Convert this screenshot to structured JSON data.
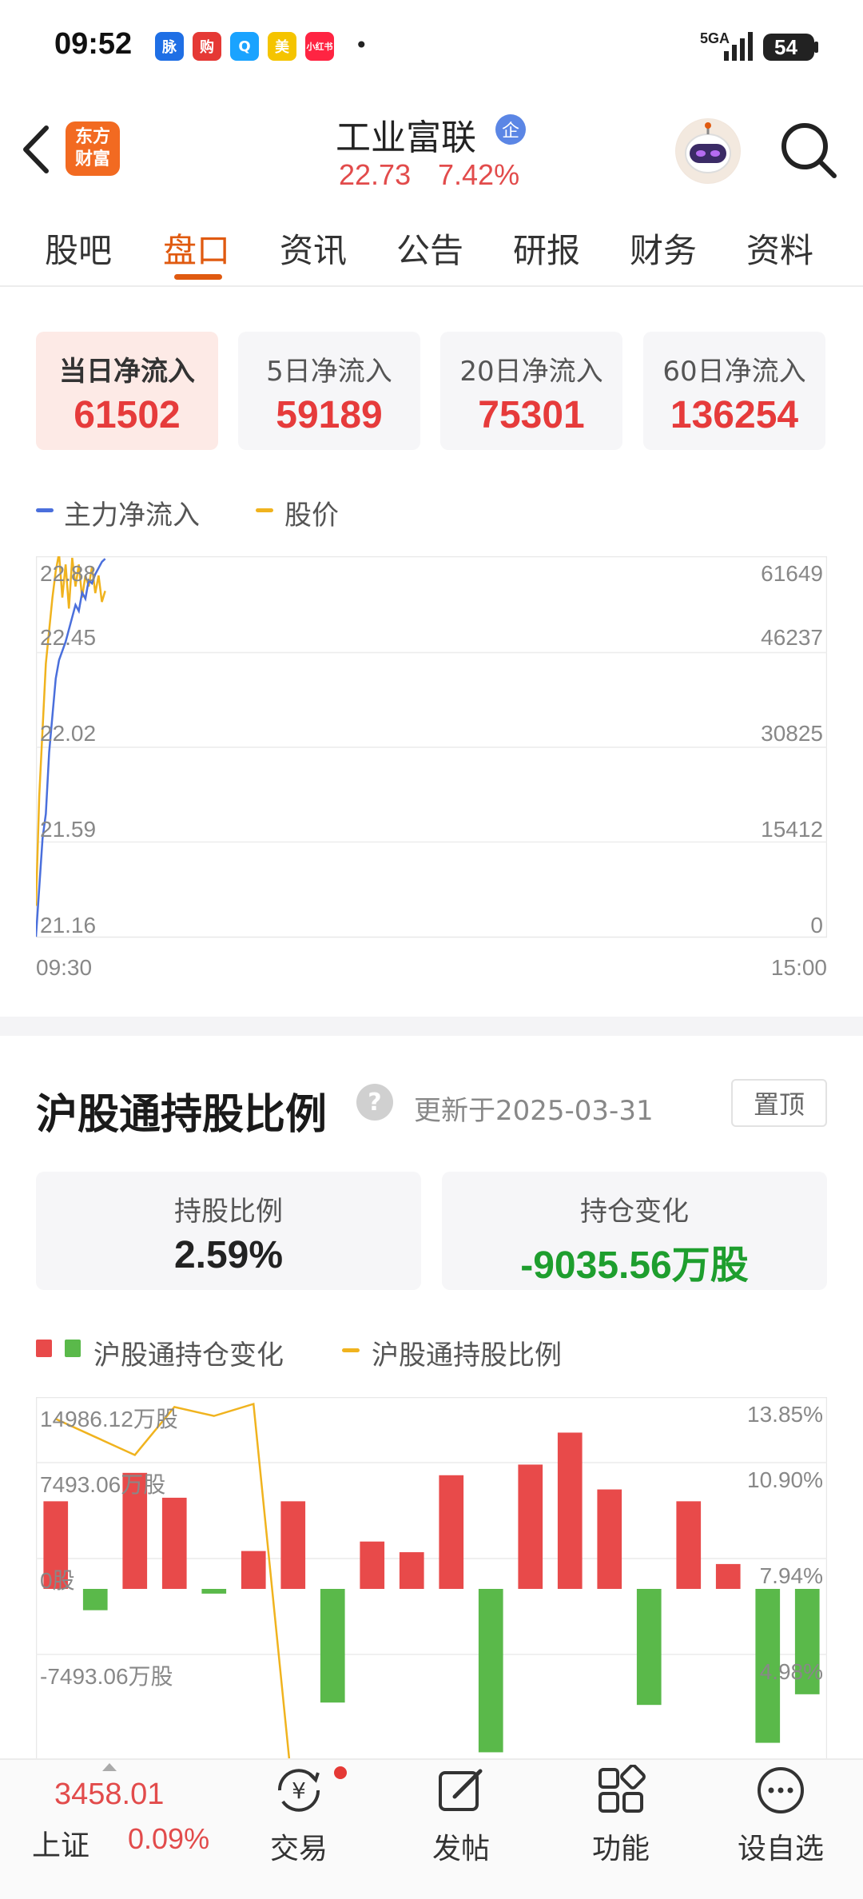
{
  "status_bar": {
    "time": "09:52",
    "network": "5GA",
    "battery": "54",
    "more": "•",
    "apps": [
      {
        "label": "脉",
        "color": "#1f6fe5"
      },
      {
        "label": "购",
        "color": "#e53935"
      },
      {
        "label": "Q",
        "color": "#1aa3ff"
      },
      {
        "label": "美",
        "color": "#f5c400"
      },
      {
        "label": "小红书",
        "color": "#ff2442"
      }
    ]
  },
  "header": {
    "logo_line1": "东方",
    "logo_line2": "财富",
    "stock_name": "工业富联",
    "badge": "企",
    "price": "22.73",
    "change_pct": "7.42%"
  },
  "tabs": [
    "股吧",
    "盘口",
    "资讯",
    "公告",
    "研报",
    "财务",
    "资料"
  ],
  "flow_cards": [
    {
      "label": "当日净流入",
      "value": "61502"
    },
    {
      "label": "5日净流入",
      "value": "59189"
    },
    {
      "label": "20日净流入",
      "value": "75301"
    },
    {
      "label": "60日净流入",
      "value": "136254"
    }
  ],
  "flow_legend": {
    "main": "主力净流入",
    "price": "股价"
  },
  "colors": {
    "main_flow": "#4a6fdc",
    "price": "#f0b31e",
    "red": "#e84a4a",
    "green": "#5ab94a",
    "accent": "#e05a10"
  },
  "chart_data": [
    {
      "type": "line",
      "y_left_ticks": [
        "22.88",
        "22.45",
        "22.02",
        "21.59",
        "21.16"
      ],
      "y_right_ticks": [
        "61649",
        "46237",
        "30825",
        "15412",
        "0"
      ],
      "x_ticks": [
        "09:30",
        "15:00"
      ],
      "ylim_left": [
        21.16,
        22.88
      ],
      "ylim_right": [
        0,
        61649
      ],
      "series": [
        {
          "name": "主力净流入",
          "axis": "right",
          "values": [
            0,
            8000,
            16000,
            20000,
            30000,
            36000,
            42000,
            45000,
            46500,
            48000,
            50000,
            52000,
            54000,
            53000,
            56000,
            55000,
            58000,
            57500,
            59000,
            60000,
            61000,
            61502
          ]
        },
        {
          "name": "股价",
          "axis": "left",
          "values": [
            21.3,
            21.8,
            22.1,
            22.4,
            22.55,
            22.7,
            22.82,
            22.9,
            22.7,
            22.85,
            22.65,
            22.88,
            22.75,
            22.85,
            22.7,
            22.8,
            22.75,
            22.84,
            22.72,
            22.8,
            22.68,
            22.73
          ]
        }
      ],
      "total_points": 241
    },
    {
      "type": "bar",
      "y_left_ticks": [
        "14986.12万股",
        "7493.06万股",
        "0股",
        "-7493.06万股"
      ],
      "y_right_ticks": [
        "13.85%",
        "10.90%",
        "7.94%",
        "4.98%"
      ],
      "ylim_left": [
        -14986.12,
        14986.12
      ],
      "ylim_right": [
        2.02,
        13.85
      ],
      "series": [
        {
          "name": "沪股通持仓变化",
          "values": [
            7400,
            -1800,
            9800,
            7700,
            -400,
            3200,
            7400,
            -9600,
            4000,
            3100,
            9600,
            -13800,
            10500,
            13200,
            8400,
            -9800,
            7400,
            2100,
            -13000,
            -8900
          ]
        },
        {
          "name": "沪股通持股比例",
          "values": [
            13.6,
            13.0,
            12.4,
            14.0,
            13.7,
            14.1,
            1.0,
            1.0,
            1.0,
            1.0,
            1.3,
            1.0,
            1.3,
            1.7,
            2.0,
            1.8,
            1.9,
            2.0,
            1.7,
            1.5
          ]
        }
      ]
    }
  ],
  "section": {
    "title": "沪股通持股比例",
    "help": "?",
    "updated": "更新于2025-03-31",
    "pin": "置顶"
  },
  "holdings": {
    "ratio_label": "持股比例",
    "ratio_value": "2.59%",
    "change_label": "持仓变化",
    "change_value": "-9035.56万股"
  },
  "hold_legend": {
    "change": "沪股通持仓变化",
    "ratio": "沪股通持股比例"
  },
  "bottom": {
    "index_value": "3458.01",
    "index_name": "上证",
    "index_pct": "0.09%",
    "nav": [
      {
        "label": "交易"
      },
      {
        "label": "发帖"
      },
      {
        "label": "功能"
      },
      {
        "label": "设自选"
      }
    ]
  }
}
